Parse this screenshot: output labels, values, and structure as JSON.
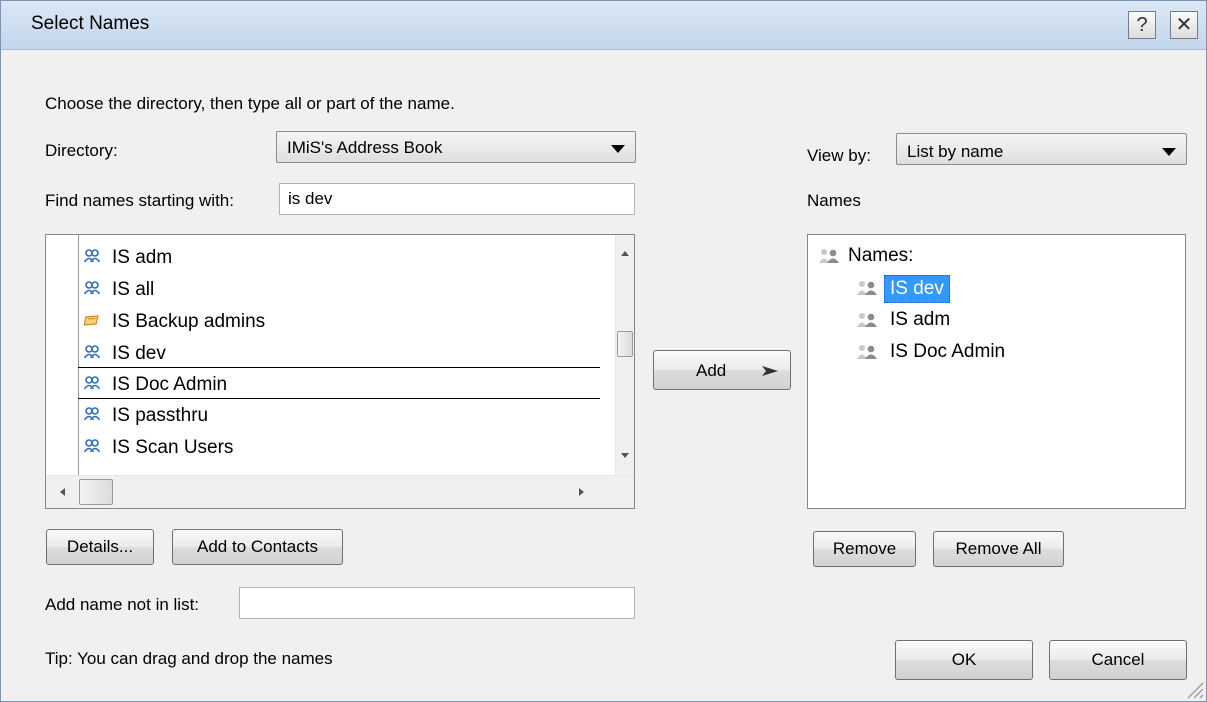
{
  "window": {
    "title": "Select Names",
    "help_label": "?",
    "close_label": "✕"
  },
  "instructions": "Choose the directory, then type all or part of the name.",
  "directory": {
    "label": "Directory:",
    "value": "IMiS's Address Book"
  },
  "find": {
    "label": "Find names starting with:",
    "value": "is dev"
  },
  "address_list": {
    "items": [
      {
        "name": "IS adm",
        "icon": "group-icon"
      },
      {
        "name": "IS all",
        "icon": "group-icon"
      },
      {
        "name": "IS Backup admins",
        "icon": "distribution-list-icon"
      },
      {
        "name": "IS dev",
        "icon": "group-icon"
      },
      {
        "name": "IS Doc Admin",
        "icon": "group-icon"
      },
      {
        "name": "IS passthru",
        "icon": "group-icon"
      },
      {
        "name": "IS Scan Users",
        "icon": "group-icon"
      }
    ]
  },
  "add_button": {
    "label": "Add"
  },
  "view_by": {
    "label": "View by:",
    "value": "List by name"
  },
  "names_panel": {
    "heading": "Names",
    "root_label": "Names:",
    "items": [
      "IS dev",
      "IS adm",
      "IS Doc Admin"
    ]
  },
  "buttons": {
    "details": "Details...",
    "add_to_contacts": "Add to Contacts",
    "remove": "Remove",
    "remove_all": "Remove All",
    "ok": "OK",
    "cancel": "Cancel"
  },
  "add_not_in_list": {
    "label": "Add name not in list:",
    "value": ""
  },
  "tip": "Tip: You can drag and drop the names",
  "colors": {
    "selection": "#3399ff",
    "titlebar": "#c3d6ed",
    "group_icon": "#2d6fb8",
    "dl_icon": "#e3a132"
  }
}
